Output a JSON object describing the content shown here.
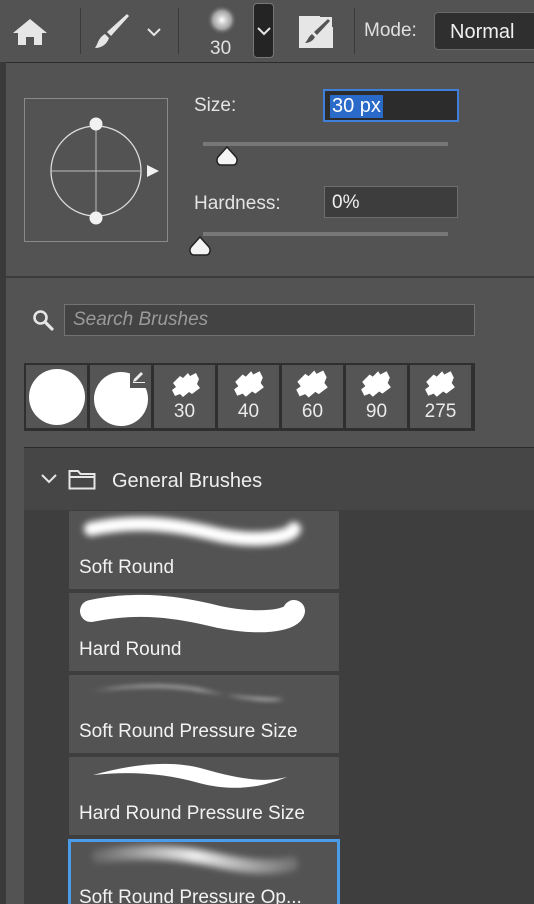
{
  "topbar": {
    "brush_size_value": "30",
    "mode_label": "Mode:",
    "mode_value": "Normal",
    "icons": [
      "home-icon",
      "brush-tool-icon",
      "chevron-down-icon",
      "brush-preview-icon",
      "brush-settings-icon"
    ]
  },
  "panel": {
    "size_label": "Size:",
    "size_value": "30 px",
    "size_fraction": 0.06,
    "hardness_label": "Hardness:",
    "hardness_value": "0%",
    "hardness_fraction": 0.0,
    "search": {
      "placeholder": "Search Brushes"
    },
    "recent_brushes": [
      {
        "label": ""
      },
      {
        "label": ""
      },
      {
        "label": "30"
      },
      {
        "label": "40"
      },
      {
        "label": "60"
      },
      {
        "label": "90"
      },
      {
        "label": "275"
      }
    ],
    "group": {
      "title": "General Brushes",
      "brushes": [
        {
          "name": "Soft Round",
          "selected": false
        },
        {
          "name": "Hard Round",
          "selected": false
        },
        {
          "name": "Soft Round Pressure Size",
          "selected": false
        },
        {
          "name": "Hard Round Pressure Size",
          "selected": false
        },
        {
          "name": "Soft Round Pressure Op...",
          "selected": true
        }
      ]
    }
  },
  "colors": {
    "panel_bg": "#535353",
    "selection_accent": "#4a9be8",
    "text_highlight": "#2a6ac8"
  }
}
